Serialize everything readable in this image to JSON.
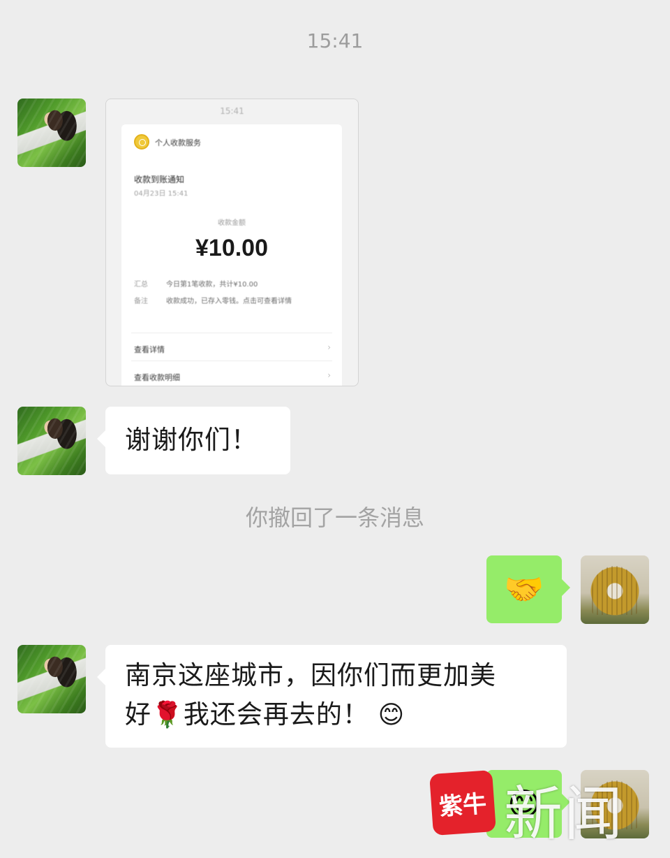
{
  "chat": {
    "timestamp": "15:41",
    "recall_notice": "你撤回了一条消息",
    "messages": [
      {
        "type": "image",
        "sender": "other",
        "screenshot": {
          "time": "15:41",
          "merchant": "个人收款服务",
          "notice_title": "收款到账通知",
          "notice_date": "04月23日 15:41",
          "amount_label": "收款金额",
          "amount": "¥10.00",
          "rows": [
            {
              "key": "汇总",
              "value": "今日第1笔收款，共计¥10.00"
            },
            {
              "key": "备注",
              "value": "收款成功，已存入零钱。点击可查看详情"
            }
          ],
          "links": [
            "查看详情",
            "查看收款明细"
          ]
        }
      },
      {
        "type": "text",
        "sender": "other",
        "text": "谢谢你们！"
      },
      {
        "type": "emoji",
        "sender": "self",
        "emoji": "🤝",
        "icon": "handshake-icon"
      },
      {
        "type": "text",
        "sender": "other",
        "text_line1": "南京这座城市，因你们而更加美",
        "text_line2_a": "好",
        "text_line2_emoji": "🌹",
        "text_line2_b": "我还会再去的！",
        "text_line2_emoji2": "😊"
      },
      {
        "type": "emoji",
        "sender": "self",
        "emoji": "😊",
        "icon": "smile-icon"
      }
    ]
  },
  "watermark": {
    "logo_text": "紫牛",
    "text": "新闻"
  },
  "colors": {
    "background": "#ededed",
    "self_bubble": "#95ec69",
    "other_bubble": "#ffffff",
    "watermark_red": "#e4222b"
  }
}
